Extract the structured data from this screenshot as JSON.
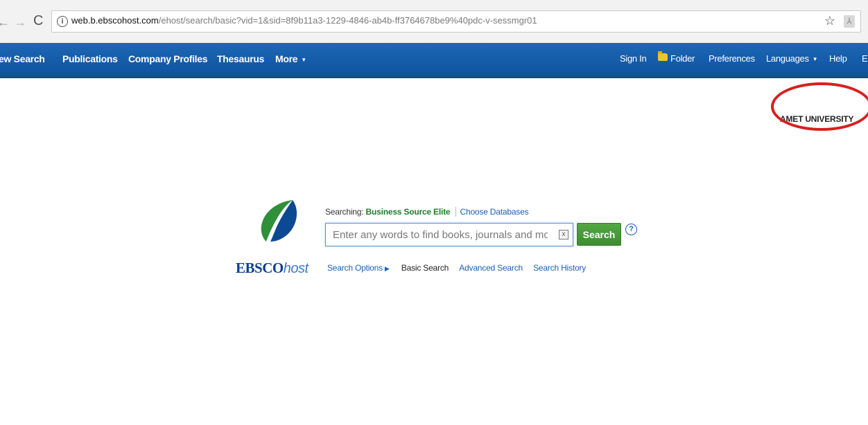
{
  "browser": {
    "url_host": "web.b.ebscohost.com",
    "url_path": "/ehost/search/basic?vid=1&sid=8f9b11a3-1229-4846-ab4b-ff3764678be9%40pdc-v-sessmgr01",
    "icons": {
      "back": "arrow-left-icon",
      "forward": "arrow-right-icon",
      "reload": "reload-icon",
      "info": "info-icon",
      "bookmark": "star-icon",
      "extension": "extension-icon"
    }
  },
  "nav": {
    "left_items": [
      {
        "label": "ew Search"
      },
      {
        "label": "Publications"
      },
      {
        "label": "Company Profiles"
      },
      {
        "label": "Thesaurus"
      },
      {
        "label": "More"
      }
    ],
    "right_items": [
      {
        "label": "Sign In"
      },
      {
        "label": "Folder"
      },
      {
        "label": "Preferences"
      },
      {
        "label": "Languages"
      },
      {
        "label": "Help"
      },
      {
        "label": "E"
      }
    ]
  },
  "institution": "AMET UNIVERSITY",
  "logo": {
    "word_main": "EBSCO",
    "word_host": "host"
  },
  "search": {
    "searching_label": "Searching:",
    "database": "Business Source Elite",
    "choose_databases": "Choose Databases",
    "placeholder": "Enter any words to find books, journals and more",
    "value": "",
    "clear_label": "x",
    "button_label": "Search",
    "help_label": "?"
  },
  "options": {
    "search_options": "Search Options",
    "basic_search": "Basic Search",
    "advanced_search": "Advanced Search",
    "search_history": "Search History"
  },
  "colors": {
    "navbar": "#1560ad",
    "search_button": "#479b3a",
    "database_name": "#1d7f2d",
    "link": "#1a5fb4",
    "highlight_circle": "#d81e1e"
  }
}
